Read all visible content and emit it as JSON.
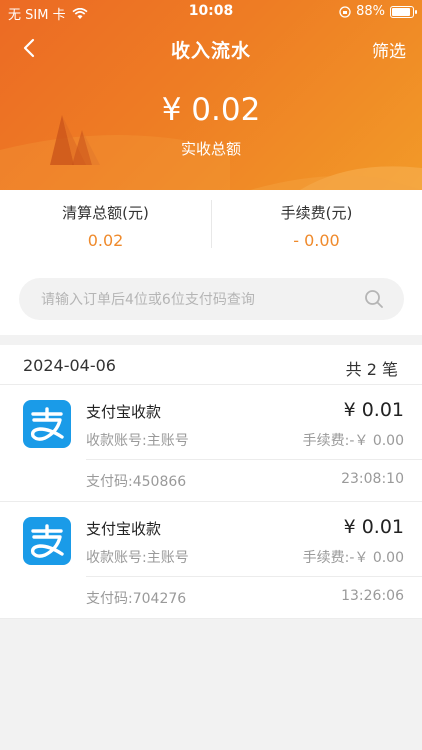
{
  "status_bar": {
    "carrier": "无 SIM 卡",
    "time": "10:08",
    "battery": "88%",
    "battery_level": 0.88
  },
  "nav": {
    "title": "收入流水",
    "filter_label": "筛选"
  },
  "header": {
    "total_amount": "¥ 0.02",
    "total_label": "实收总额"
  },
  "summary": {
    "settle_label": "清算总额(元)",
    "settle_value": "0.02",
    "fee_label": "手续费(元)",
    "fee_value": "- 0.00"
  },
  "search": {
    "placeholder": "请输入订单后4位或6位支付码查询"
  },
  "group": {
    "date": "2024-04-06",
    "count": "共 2 笔"
  },
  "transactions": [
    {
      "title": "支付宝收款",
      "account": "收款账号:主账号",
      "amount": "¥ 0.01",
      "fee": "手续费:-￥ 0.00",
      "code": "支付码:450866",
      "time": "23:08:10"
    },
    {
      "title": "支付宝收款",
      "account": "收款账号:主账号",
      "amount": "¥ 0.01",
      "fee": "手续费:-￥ 0.00",
      "code": "支付码:704276",
      "time": "13:26:06"
    }
  ],
  "colors": {
    "header_orange": "#ee7d24",
    "accent_value": "#ef8a2c",
    "alipay_blue": "#1a9be8"
  }
}
